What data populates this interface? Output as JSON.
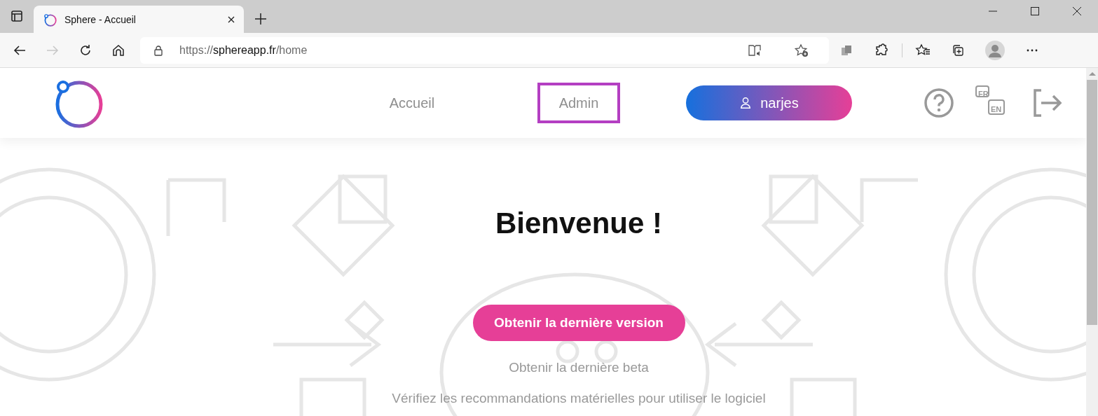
{
  "browser": {
    "tab": {
      "title": "Sphere - Accueil",
      "selected": true
    },
    "address": {
      "scheme": "https://",
      "host": "sphereapp.fr",
      "path": "/home"
    },
    "forward_disabled": true
  },
  "header": {
    "nav": [
      {
        "label": "Accueil",
        "highlighted": false
      },
      {
        "label": "Admin",
        "highlighted": true
      }
    ],
    "user_button": "narjes",
    "language_icon": {
      "from": "FR",
      "to": "EN"
    }
  },
  "main": {
    "title": "Bienvenue !",
    "primary_button": "Obtenir la dernière version",
    "beta_link": "Obtenir la dernière beta",
    "requirements_link": "Vérifiez les recommandations matérielles pour utiliser le logiciel"
  }
}
